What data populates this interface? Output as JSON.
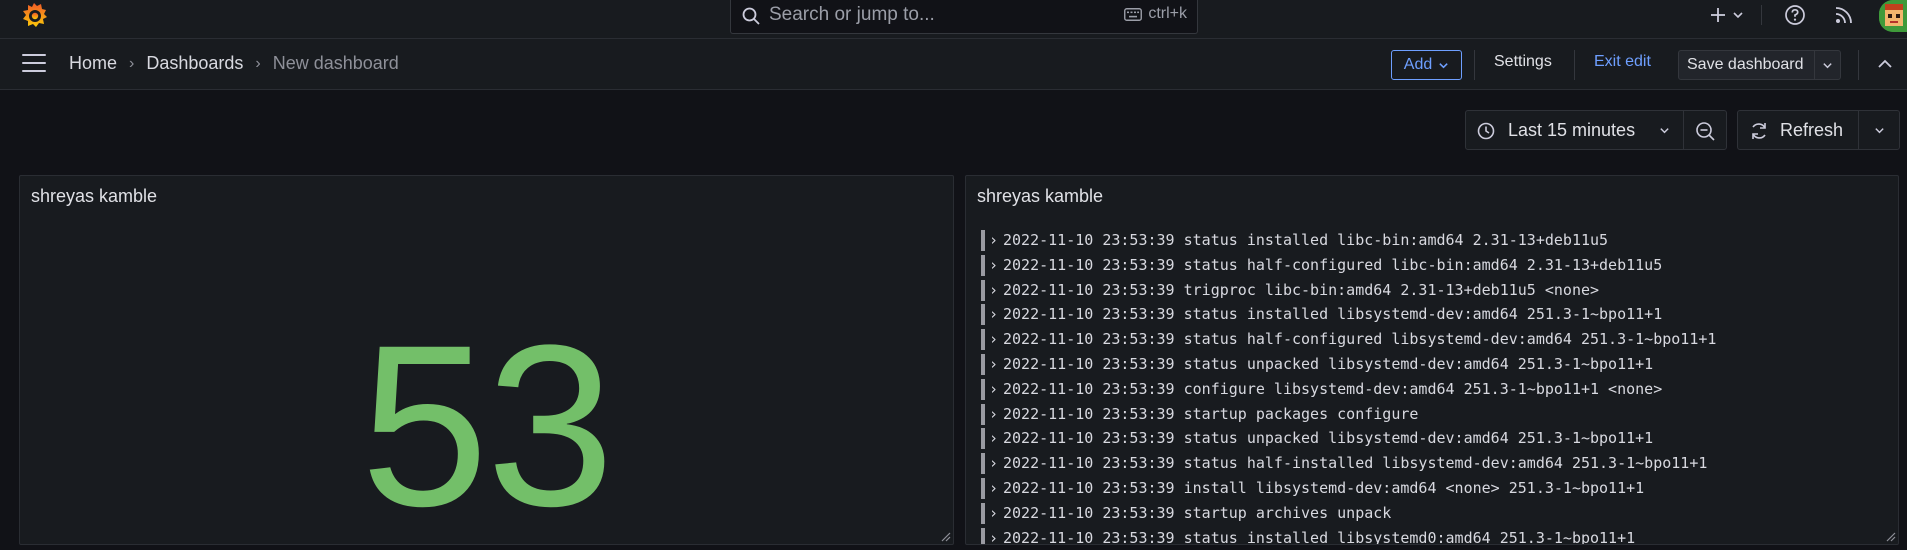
{
  "search": {
    "placeholder": "Search or jump to...",
    "shortcut": "ctrl+k"
  },
  "breadcrumb": [
    "Home",
    "Dashboards",
    "New dashboard"
  ],
  "toolbar": {
    "add_label": "Add",
    "settings_label": "Settings",
    "exit_edit_label": "Exit edit",
    "save_label": "Save dashboard"
  },
  "time": {
    "range_label": "Last 15 minutes",
    "refresh_label": "Refresh"
  },
  "panels": {
    "stat": {
      "title": "shreyas kamble",
      "value": "53",
      "color": "#73bf69"
    },
    "logs": {
      "title": "shreyas kamble",
      "lines": [
        "2022-11-10 23:53:39 status installed libc-bin:amd64 2.31-13+deb11u5",
        "2022-11-10 23:53:39 status half-configured libc-bin:amd64 2.31-13+deb11u5",
        "2022-11-10 23:53:39 trigproc libc-bin:amd64 2.31-13+deb11u5 <none>",
        "2022-11-10 23:53:39 status installed libsystemd-dev:amd64 251.3-1~bpo11+1",
        "2022-11-10 23:53:39 status half-configured libsystemd-dev:amd64 251.3-1~bpo11+1",
        "2022-11-10 23:53:39 status unpacked libsystemd-dev:amd64 251.3-1~bpo11+1",
        "2022-11-10 23:53:39 configure libsystemd-dev:amd64 251.3-1~bpo11+1 <none>",
        "2022-11-10 23:53:39 startup packages configure",
        "2022-11-10 23:53:39 status unpacked libsystemd-dev:amd64 251.3-1~bpo11+1",
        "2022-11-10 23:53:39 status half-installed libsystemd-dev:amd64 251.3-1~bpo11+1",
        "2022-11-10 23:53:39 install libsystemd-dev:amd64 <none> 251.3-1~bpo11+1",
        "2022-11-10 23:53:39 startup archives unpack",
        "2022-11-10 23:53:39 status installed libsystemd0:amd64 251.3-1~bpo11+1"
      ]
    }
  },
  "colors": {
    "accent": "#6e9fff",
    "stat_green": "#73bf69",
    "background": "#111217",
    "panel": "#181b1f"
  },
  "icons": [
    "grafana-logo-icon",
    "search-icon",
    "keyboard-icon",
    "plus-icon",
    "help-icon",
    "rss-icon",
    "hamburger-icon",
    "clock-icon",
    "zoom-out-icon",
    "refresh-icon",
    "chevron-down-icon",
    "chevron-right-icon"
  ]
}
